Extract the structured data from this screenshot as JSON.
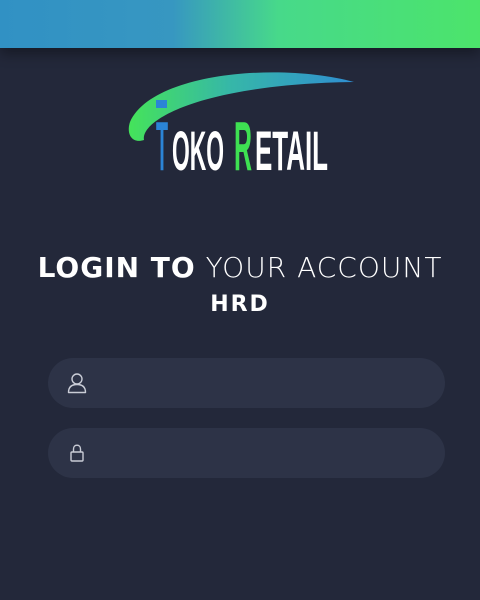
{
  "header": {
    "gradient_start": "#3191c4",
    "gradient_end": "#4ce46b"
  },
  "logo": {
    "text_part1_initial": "T",
    "text_part1_rest": "OKO",
    "text_part2_initial": "R",
    "text_part2_rest": "ETAIL",
    "colors": {
      "swoosh_blue": "#2f8ed1",
      "swoosh_green": "#45e35a",
      "initial_t": "#2b84d6",
      "initial_r": "#3ee052",
      "letters": "#ffffff"
    }
  },
  "login": {
    "title_bold": "LOGIN TO",
    "title_light": "YOUR ACCOUNT",
    "subtitle": "HRD"
  },
  "form": {
    "username": {
      "icon": "user-icon",
      "value": "",
      "placeholder": ""
    },
    "password": {
      "icon": "lock-icon",
      "value": "",
      "placeholder": ""
    }
  },
  "colors": {
    "background": "#23283a",
    "field_bg": "#2d3347",
    "icon": "#c9ccd6"
  }
}
